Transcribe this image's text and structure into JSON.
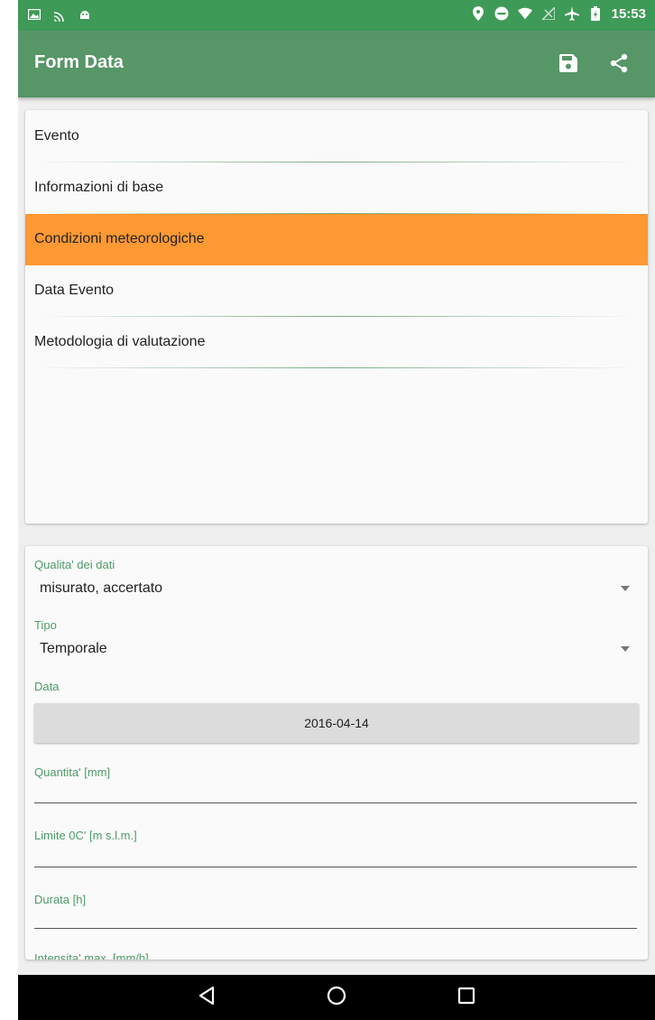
{
  "status_bar": {
    "time": "15:53",
    "left_icons": [
      "image-icon",
      "cast-icon",
      "android-icon"
    ],
    "right_icons": [
      "location-icon",
      "do-not-disturb-icon",
      "wifi-icon",
      "signal-icon",
      "airplane-icon",
      "battery-icon"
    ]
  },
  "toolbar": {
    "title": "Form Data",
    "actions": [
      "save-icon",
      "share-icon"
    ]
  },
  "menu": {
    "items": [
      {
        "label": "Evento",
        "active": false
      },
      {
        "label": "Informazioni di base",
        "active": false
      },
      {
        "label": "Condizioni meteorologiche",
        "active": true
      },
      {
        "label": "Data Evento",
        "active": false
      },
      {
        "label": "Metodologia di valutazione",
        "active": false
      }
    ]
  },
  "form": {
    "qualita": {
      "label": "Qualita' dei dati",
      "value": "misurato, accertato"
    },
    "tipo": {
      "label": "Tipo",
      "value": "Temporale"
    },
    "data": {
      "label": "Data",
      "value": "2016-04-14"
    },
    "quantita": {
      "label": "Quantita' [mm]",
      "value": ""
    },
    "limite": {
      "label": "Limite 0C' [m s.l.m.]",
      "value": ""
    },
    "durata": {
      "label": "Durata [h]",
      "value": ""
    },
    "intensita": {
      "label": "Intensita' max. [mm/h]",
      "value": ""
    }
  },
  "colors": {
    "status_bar": "#3e9a57",
    "toolbar": "#579667",
    "active_item": "#ff9933",
    "field_label": "#4e9a67"
  },
  "nav_bar": {
    "buttons": [
      "back-icon",
      "home-icon",
      "recents-icon"
    ]
  }
}
